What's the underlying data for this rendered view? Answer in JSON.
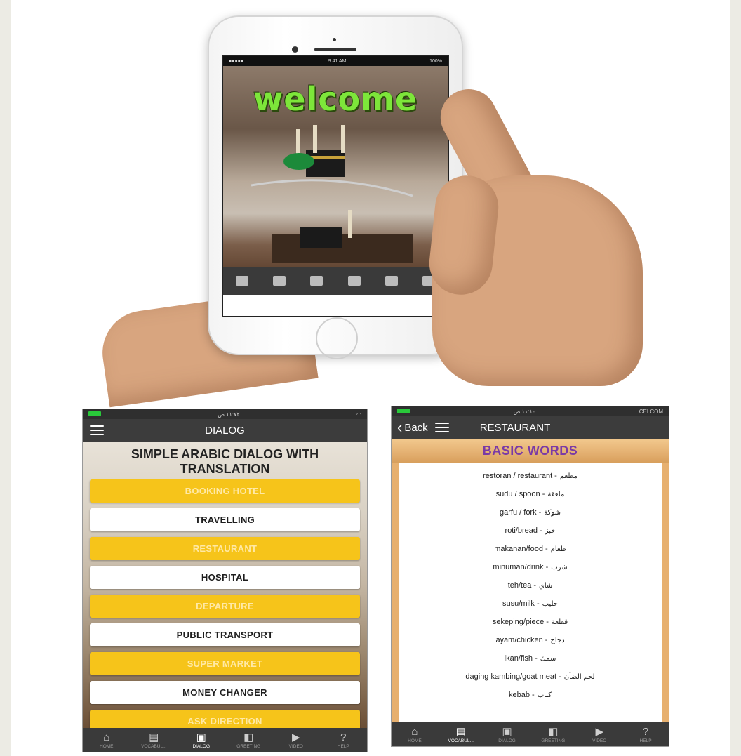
{
  "phone": {
    "status_time": "9:41 AM",
    "status_battery": "100%",
    "welcome_text": "welcome"
  },
  "dialog_screen": {
    "status_time": "١١:٧٢ ص",
    "nav_title": "DIALOG",
    "heading": "SIMPLE ARABIC DIALOG WITH TRANSLATION",
    "items": [
      {
        "label": "BOOKING HOTEL",
        "style": "yellow"
      },
      {
        "label": "TRAVELLING",
        "style": "white"
      },
      {
        "label": "RESTAURANT",
        "style": "yellow"
      },
      {
        "label": "HOSPITAL",
        "style": "white"
      },
      {
        "label": "DEPARTURE",
        "style": "yellow"
      },
      {
        "label": "PUBLIC TRANSPORT",
        "style": "white"
      },
      {
        "label": "SUPER MARKET",
        "style": "yellow"
      },
      {
        "label": "MONEY CHANGER",
        "style": "white"
      },
      {
        "label": "ASK DIRECTION",
        "style": "yellow"
      }
    ],
    "tabs": [
      "HOME",
      "VOCABUL...",
      "DIALOG",
      "GREETING",
      "VIDEO",
      "HELP"
    ]
  },
  "restaurant_screen": {
    "status_time": "١١:١٠ ص",
    "status_carrier": "CELCOM",
    "back_label": "Back",
    "nav_title": "RESTAURANT",
    "section_title": "BASIC WORDS",
    "words": [
      {
        "latin": "restoran / restaurant -",
        "arabic": "مطعم"
      },
      {
        "latin": "sudu / spoon -",
        "arabic": "ملعقة"
      },
      {
        "latin": "garfu / fork -",
        "arabic": "شوكة"
      },
      {
        "latin": "roti/bread -",
        "arabic": "خبز"
      },
      {
        "latin": "makanan/food -",
        "arabic": "طعام"
      },
      {
        "latin": "minuman/drink -",
        "arabic": "شرب"
      },
      {
        "latin": "teh/tea -",
        "arabic": "شاي"
      },
      {
        "latin": "susu/milk -",
        "arabic": "حليب"
      },
      {
        "latin": "sekeping/piece -",
        "arabic": "قطعة"
      },
      {
        "latin": "ayam/chicken -",
        "arabic": "دجاج"
      },
      {
        "latin": "ikan/fish -",
        "arabic": "سمك"
      },
      {
        "latin": "daging kambing/goat meat -",
        "arabic": "لحم الضأن"
      },
      {
        "latin": "kebab -",
        "arabic": "كباب"
      }
    ],
    "tabs": [
      "HOME",
      "VOCABUL...",
      "DIALOG",
      "GREETING",
      "VIDEO",
      "HELP"
    ]
  },
  "icons": {
    "home": "home-icon",
    "vocabulary": "book-icon",
    "dialog": "chat-bubble-icon",
    "greeting": "speech-bubbles-icon",
    "video": "video-play-icon",
    "help": "help-icon"
  },
  "colors": {
    "accent_yellow": "#f6c41a",
    "toolbar_dark": "#3a3a3a",
    "title_purple": "#7a3aa6",
    "welcome_green": "#7de63a"
  }
}
